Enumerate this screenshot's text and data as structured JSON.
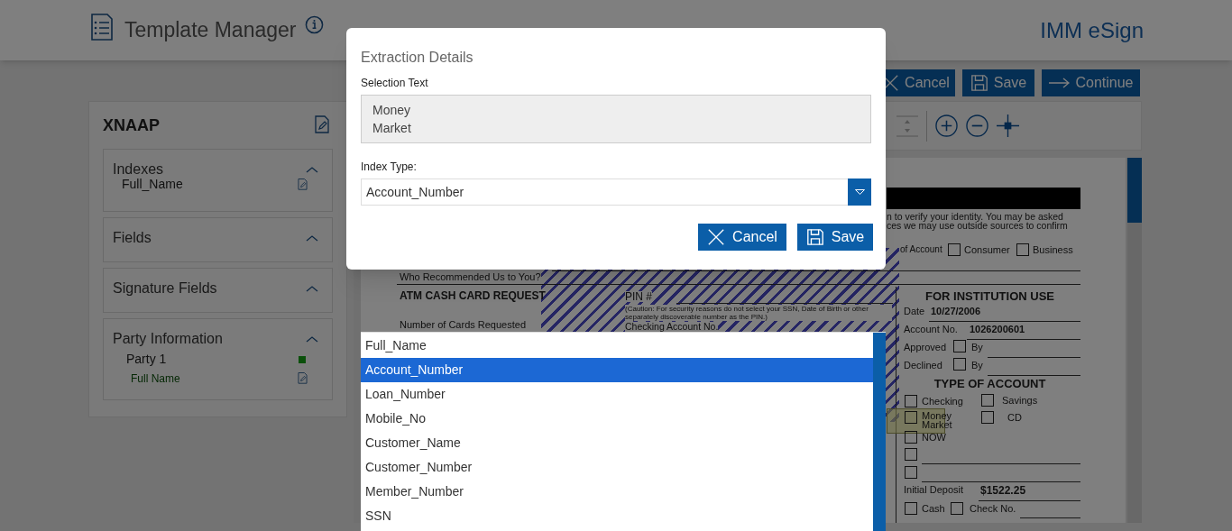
{
  "header": {
    "title": "Template Manager",
    "brand": "IMM eSign"
  },
  "toolbar_buttons": [
    {
      "kind": "cancel",
      "label": "Cancel"
    },
    {
      "kind": "save",
      "label": "Save"
    },
    {
      "kind": "continue",
      "label": "Continue"
    }
  ],
  "template": {
    "name": "XNAAP",
    "sections": [
      {
        "title": "Indexes",
        "expanded": true,
        "items": [
          {
            "label": "Full_Name"
          }
        ]
      },
      {
        "title": "Fields",
        "expanded": true
      },
      {
        "title": "Signature Fields",
        "expanded": true
      },
      {
        "title": "Party Information",
        "expanded": true,
        "parties": [
          {
            "name": "Party 1",
            "color": "#0b500b",
            "fields": [
              {
                "label": "Full Name"
              }
            ]
          }
        ]
      }
    ]
  },
  "document": {
    "identity_lines": [
      "n to verify your identity. You may be asked",
      "ces we may use outside sources to confirm"
    ],
    "account_type": {
      "label": "of Account",
      "options": [
        {
          "label": "Consumer",
          "checked": false
        },
        {
          "label": "Business",
          "checked": false
        }
      ]
    },
    "recommended_label": "Who Recommended Us to You?",
    "atm_heading": "ATM CASH CARD REQUEST",
    "pin_label": "PIN #",
    "pin_caution": "(Caution: For security reasons do not select your SSN, Date of Birth or other separately discoverable number as the PIN.)",
    "cards_label": "Number of Cards Requested",
    "checking_label": "Checking Account No.",
    "institution": {
      "heading": "FOR INSTITUTION USE",
      "date_label": "Date",
      "date": "10/27/2006",
      "account_label": "Account No.",
      "account": "1026200601",
      "approvals": [
        {
          "label": "Approved",
          "checked": false,
          "by": "By"
        },
        {
          "label": "Declined",
          "checked": false,
          "by": "By"
        }
      ],
      "type_heading": "TYPE OF ACCOUNT",
      "types": [
        {
          "label": "Checking",
          "checked": false,
          "highlighted": false
        },
        {
          "label": "Savings",
          "checked": false,
          "highlighted": false
        },
        {
          "label": "Money Market",
          "checked": false,
          "highlighted": true
        },
        {
          "label": "CD",
          "checked": false,
          "highlighted": false
        },
        {
          "label": "NOW",
          "checked": false,
          "highlighted": false
        }
      ],
      "blank_rows": [
        {
          "checked": false
        },
        {
          "checked": false
        }
      ],
      "deposit_label": "Initial Deposit",
      "deposit": "$1522.25",
      "payment": [
        {
          "label": "Cash",
          "checked": false
        },
        {
          "label": "Check No.",
          "checked": false
        }
      ]
    }
  },
  "modal": {
    "title": "Extraction Details",
    "selection_label": "Selection Text",
    "selection_text": [
      "Money",
      "Market"
    ],
    "index_type_label": "Index Type:",
    "index_type_value": "Account_Number",
    "buttons": [
      {
        "kind": "cancel",
        "label": "Cancel"
      },
      {
        "kind": "save",
        "label": "Save"
      }
    ]
  },
  "dropdown": {
    "options": [
      {
        "label": "Full_Name",
        "selected": false
      },
      {
        "label": "Account_Number",
        "selected": true
      },
      {
        "label": "Loan_Number",
        "selected": false
      },
      {
        "label": "Mobile_No",
        "selected": false
      },
      {
        "label": "Customer_Name",
        "selected": false
      },
      {
        "label": "Customer_Number",
        "selected": false
      },
      {
        "label": "Member_Number",
        "selected": false
      },
      {
        "label": "SSN",
        "selected": false
      }
    ]
  }
}
